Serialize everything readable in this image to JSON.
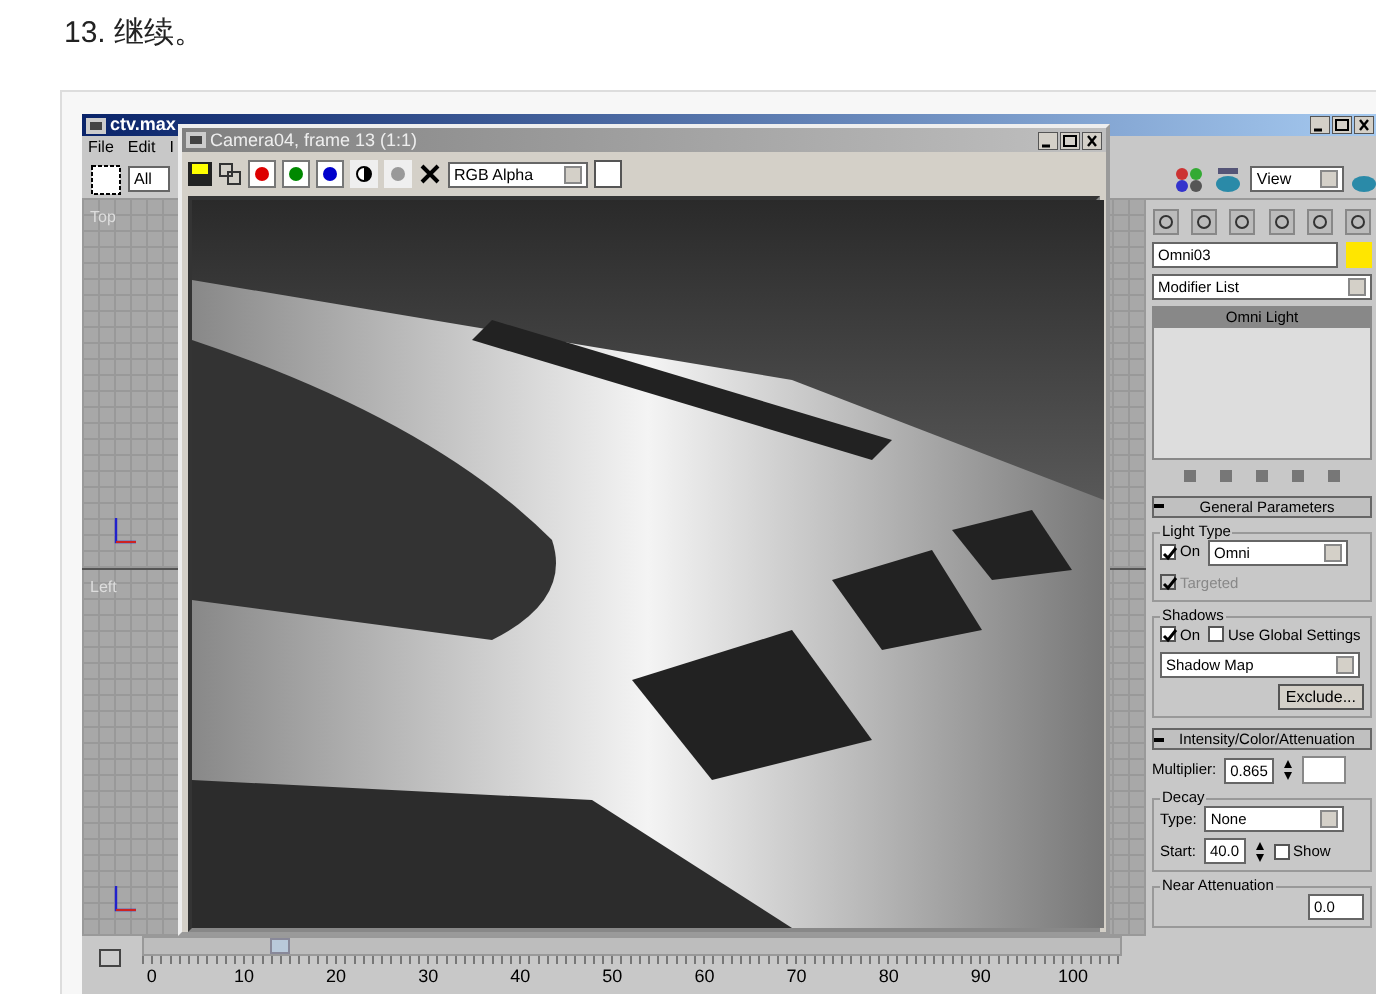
{
  "heading": "13. 继续。",
  "app_window": {
    "title": "ctv.max",
    "menu": [
      "File",
      "Edit",
      "I"
    ],
    "selection_filter": "All",
    "view_dropdown": "View"
  },
  "viewports": [
    {
      "label": "Top"
    },
    {
      "label": "Left"
    }
  ],
  "render_window": {
    "title": "Camera04, frame 13 (1:1)",
    "channel_dropdown": "RGB Alpha",
    "channels": [
      {
        "kind": "red",
        "on": true
      },
      {
        "kind": "green",
        "on": true
      },
      {
        "kind": "blue",
        "on": true
      },
      {
        "kind": "mono",
        "on": false
      },
      {
        "kind": "alpha",
        "on": false
      }
    ]
  },
  "command_panel": {
    "object": {
      "name": "Omni03",
      "color": "#ffe600"
    },
    "modifier_list": "Modifier List",
    "stack": [
      {
        "label": "Omni Light",
        "selected": true
      }
    ],
    "general_parameters": {
      "title": "General Parameters",
      "light_type_label": "Light Type",
      "light_on": {
        "label": "On",
        "checked": true
      },
      "light_type": "Omni",
      "targeted": {
        "label": "Targeted",
        "checked": true,
        "disabled": true
      },
      "shadows_label": "Shadows",
      "shadows_on": {
        "label": "On",
        "checked": true
      },
      "use_global": {
        "label": "Use Global Settings",
        "checked": false
      },
      "shadow_type": "Shadow Map",
      "exclude_button": "Exclude..."
    },
    "intensity": {
      "title": "Intensity/Color/Attenuation",
      "multiplier_label": "Multiplier:",
      "multiplier": "0.865",
      "decay_label": "Decay",
      "type_label": "Type:",
      "decay_type": "None",
      "start_label": "Start:",
      "start": "40.0",
      "show": {
        "label": "Show",
        "checked": false
      },
      "near_label": "Near Attenuation",
      "near_start": "0.0"
    }
  },
  "timeline": {
    "level": 0.13,
    "ticks": [
      "0",
      "10",
      "20",
      "30",
      "40",
      "50",
      "60",
      "70",
      "80",
      "90",
      "100"
    ]
  }
}
